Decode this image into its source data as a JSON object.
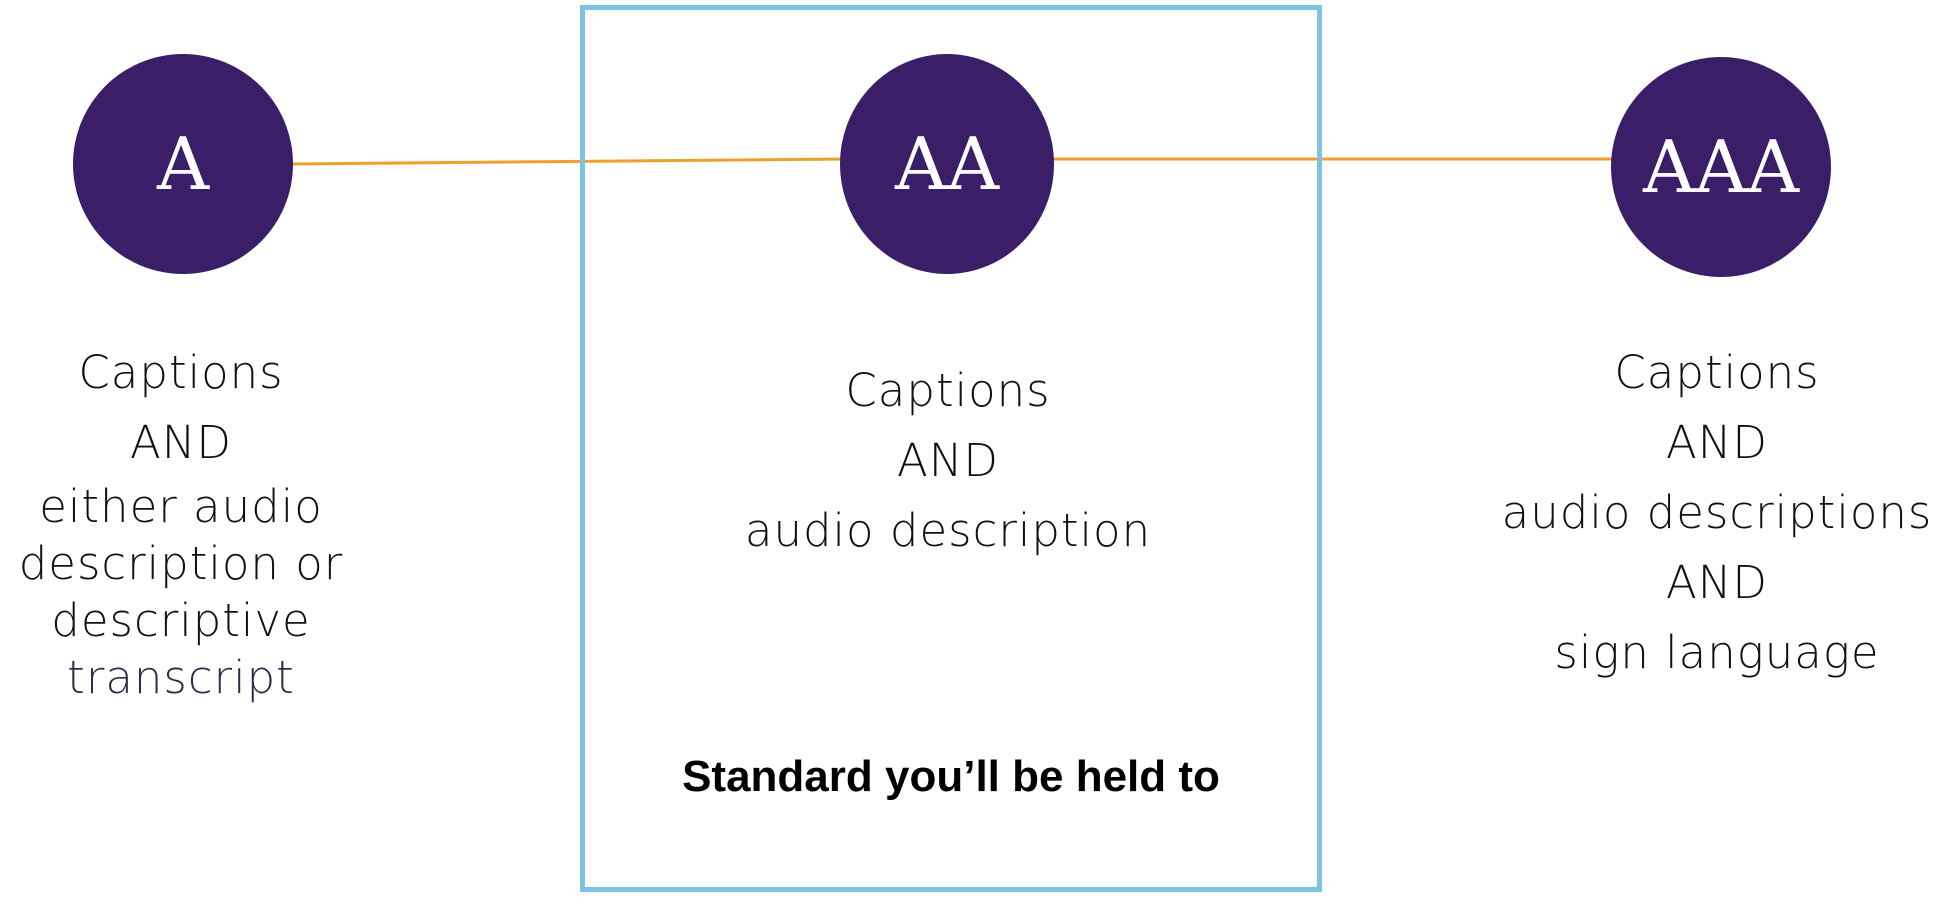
{
  "colors": {
    "circle_fill": "#3a1f68",
    "connector_line": "#f0a02a",
    "highlight_border": "#7dc3e3"
  },
  "levels": [
    {
      "badge": "A",
      "lines": [
        "Captions",
        "AND",
        "either audio",
        "description or",
        "descriptive",
        "transcript"
      ]
    },
    {
      "badge": "AA",
      "lines": [
        "Captions",
        "AND",
        "audio description"
      ]
    },
    {
      "badge": "AAA",
      "lines": [
        "Captions",
        "AND",
        "audio descriptions",
        "AND",
        "sign language"
      ]
    }
  ],
  "highlight_note": "Standard you’ll be held to"
}
